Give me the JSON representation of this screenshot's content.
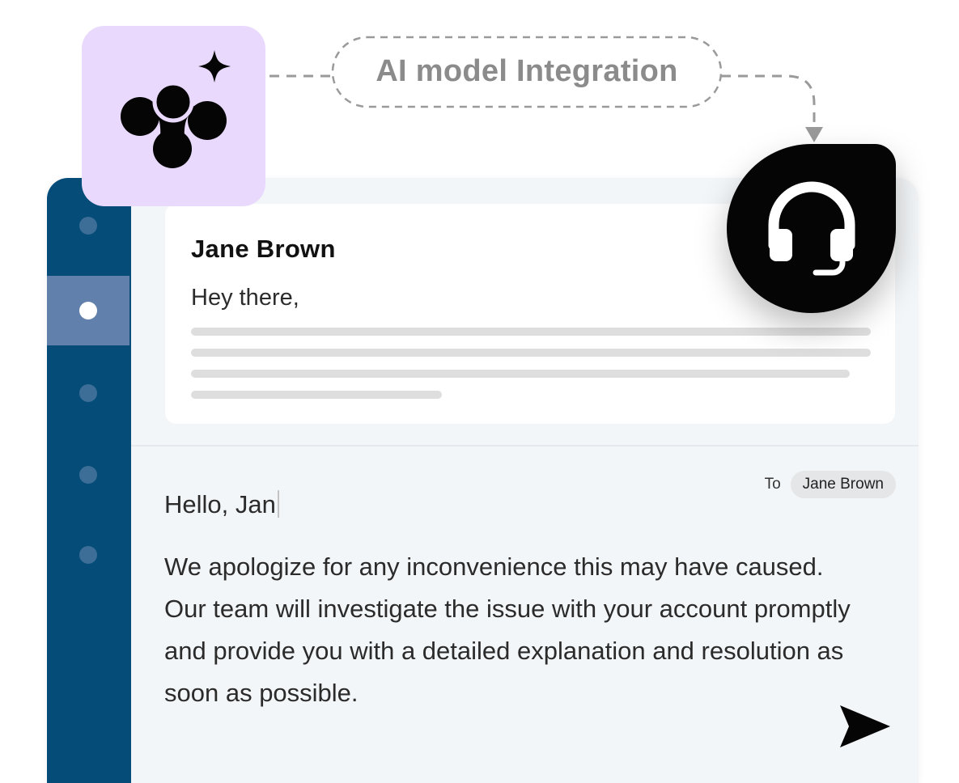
{
  "integration": {
    "label": "AI model Integration"
  },
  "icons": {
    "ai": "ai-sparkle-logo-icon",
    "support": "headset-icon",
    "send": "send-icon"
  },
  "colors": {
    "sidebar": "#054d78",
    "sidebar_active": "#6280ac",
    "ai_badge": "#e9d9fd",
    "support_badge": "#050505"
  },
  "sidebar": {
    "items": [
      {
        "active": false
      },
      {
        "active": true
      },
      {
        "active": false
      },
      {
        "active": false
      },
      {
        "active": false
      }
    ]
  },
  "message": {
    "sender": "Jane Brown",
    "greeting": "Hey there,"
  },
  "reply": {
    "to_label": "To",
    "recipient": "Jane Brown",
    "greeting": "Hello, Jan",
    "body": "We apologize for any inconvenience this may have caused. Our team will investigate the issue with your account promptly and provide you with a detailed explanation and resolution as soon as possible."
  }
}
